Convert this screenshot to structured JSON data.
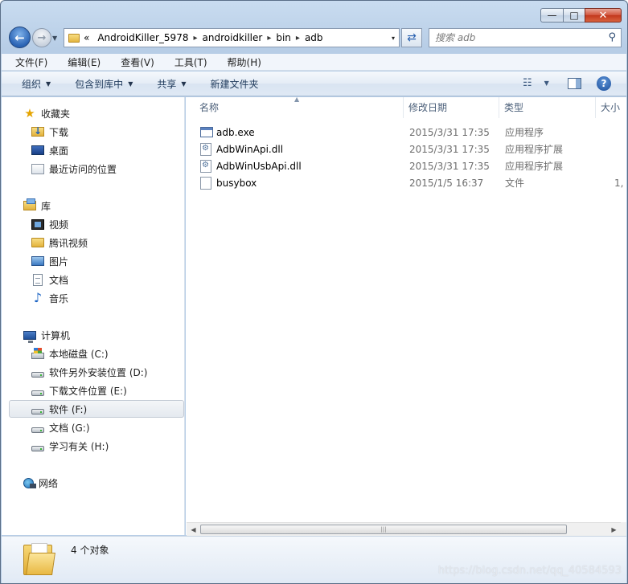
{
  "window": {
    "caption_min": "—",
    "caption_max": "□",
    "caption_close": "✕"
  },
  "address": {
    "history_glyph": "«",
    "segments": [
      "AndroidKiller_5978",
      "androidkiller",
      "bin",
      "adb"
    ],
    "separator": "▸",
    "dropdown_glyph": "▾"
  },
  "search": {
    "placeholder": "搜索 adb"
  },
  "menu": [
    "文件(F)",
    "编辑(E)",
    "查看(V)",
    "工具(T)",
    "帮助(H)"
  ],
  "commands": {
    "organize": "组织",
    "include_in_library": "包含到库中",
    "share": "共享",
    "new_folder": "新建文件夹",
    "help_glyph": "?"
  },
  "nav": {
    "favorites": "收藏夹",
    "downloads": "下载",
    "desktop": "桌面",
    "recent": "最近访问的位置",
    "libraries": "库",
    "videos": "视频",
    "tencent_video": "腾讯视频",
    "pictures": "图片",
    "documents": "文档",
    "music": "音乐",
    "computer": "计算机",
    "drive_c": "本地磁盘 (C:)",
    "drive_d": "软件另外安装位置 (D:)",
    "drive_e": "下载文件位置 (E:)",
    "drive_f": "软件 (F:)",
    "drive_g": "文档 (G:)",
    "drive_h": "学习有关 (H:)",
    "network": "网络"
  },
  "columns": {
    "name": "名称",
    "modified": "修改日期",
    "type": "类型",
    "size": "大小"
  },
  "files": [
    {
      "name": "adb.exe",
      "modified": "2015/3/31 17:35",
      "type": "应用程序",
      "size": ""
    },
    {
      "name": "AdbWinApi.dll",
      "modified": "2015/3/31 17:35",
      "type": "应用程序扩展",
      "size": ""
    },
    {
      "name": "AdbWinUsbApi.dll",
      "modified": "2015/3/31 17:35",
      "type": "应用程序扩展",
      "size": ""
    },
    {
      "name": "busybox",
      "modified": "2015/1/5 16:37",
      "type": "文件",
      "size": "1,"
    }
  ],
  "status": {
    "count": "4 个对象",
    "watermark": "https://blog.csdn.net/qq_40584593"
  }
}
